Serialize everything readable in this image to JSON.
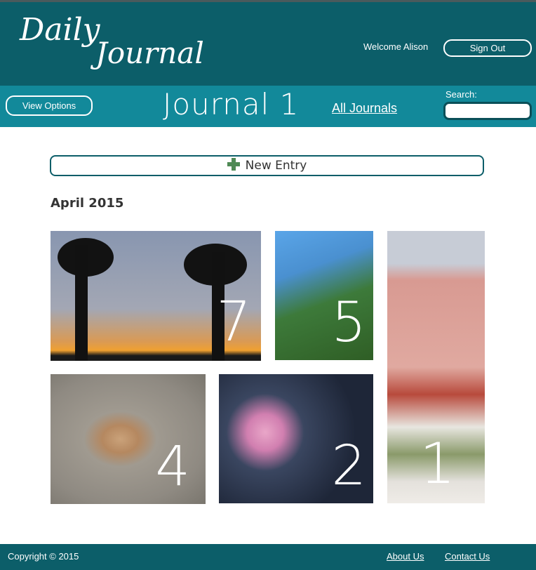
{
  "header": {
    "logo_line1": "Daily",
    "logo_line2": "Journal",
    "welcome": "Welcome Alison",
    "sign_out": "Sign Out"
  },
  "navbar": {
    "view_options": "View Options",
    "journal_title": "Journal 1",
    "all_journals": "All Journals",
    "search_label": "Search:",
    "search_value": ""
  },
  "main": {
    "new_entry": "New Entry",
    "month": "April 2015",
    "entries": [
      {
        "number": "7",
        "image": "palm-trees-sunset"
      },
      {
        "number": "5",
        "image": "palm-tree-blue-sky"
      },
      {
        "number": "1",
        "image": "pink-hotel-beach"
      },
      {
        "number": "4",
        "image": "seashell-on-sand"
      },
      {
        "number": "2",
        "image": "pink-starfish"
      }
    ]
  },
  "footer": {
    "copyright": "Copyright © 2015",
    "about": "About Us",
    "contact": "Contact Us"
  },
  "colors": {
    "header_bg": "#0c5e69",
    "navbar_bg": "#12899a",
    "plus_green": "#4f8a55"
  }
}
